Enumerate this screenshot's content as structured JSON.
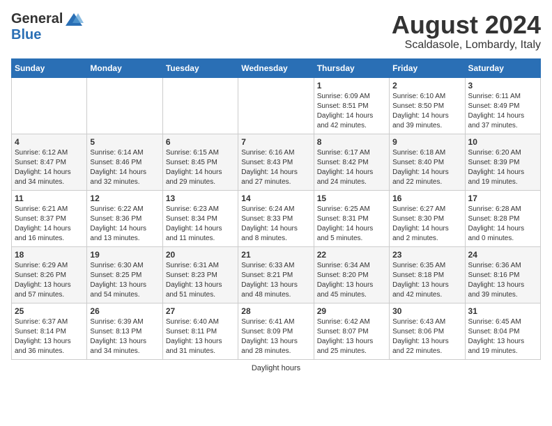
{
  "header": {
    "logo_line1": "General",
    "logo_line2": "Blue",
    "month_year": "August 2024",
    "location": "Scaldasole, Lombardy, Italy"
  },
  "days_of_week": [
    "Sunday",
    "Monday",
    "Tuesday",
    "Wednesday",
    "Thursday",
    "Friday",
    "Saturday"
  ],
  "weeks": [
    [
      {
        "day": "",
        "info": ""
      },
      {
        "day": "",
        "info": ""
      },
      {
        "day": "",
        "info": ""
      },
      {
        "day": "",
        "info": ""
      },
      {
        "day": "1",
        "info": "Sunrise: 6:09 AM\nSunset: 8:51 PM\nDaylight: 14 hours\nand 42 minutes."
      },
      {
        "day": "2",
        "info": "Sunrise: 6:10 AM\nSunset: 8:50 PM\nDaylight: 14 hours\nand 39 minutes."
      },
      {
        "day": "3",
        "info": "Sunrise: 6:11 AM\nSunset: 8:49 PM\nDaylight: 14 hours\nand 37 minutes."
      }
    ],
    [
      {
        "day": "4",
        "info": "Sunrise: 6:12 AM\nSunset: 8:47 PM\nDaylight: 14 hours\nand 34 minutes."
      },
      {
        "day": "5",
        "info": "Sunrise: 6:14 AM\nSunset: 8:46 PM\nDaylight: 14 hours\nand 32 minutes."
      },
      {
        "day": "6",
        "info": "Sunrise: 6:15 AM\nSunset: 8:45 PM\nDaylight: 14 hours\nand 29 minutes."
      },
      {
        "day": "7",
        "info": "Sunrise: 6:16 AM\nSunset: 8:43 PM\nDaylight: 14 hours\nand 27 minutes."
      },
      {
        "day": "8",
        "info": "Sunrise: 6:17 AM\nSunset: 8:42 PM\nDaylight: 14 hours\nand 24 minutes."
      },
      {
        "day": "9",
        "info": "Sunrise: 6:18 AM\nSunset: 8:40 PM\nDaylight: 14 hours\nand 22 minutes."
      },
      {
        "day": "10",
        "info": "Sunrise: 6:20 AM\nSunset: 8:39 PM\nDaylight: 14 hours\nand 19 minutes."
      }
    ],
    [
      {
        "day": "11",
        "info": "Sunrise: 6:21 AM\nSunset: 8:37 PM\nDaylight: 14 hours\nand 16 minutes."
      },
      {
        "day": "12",
        "info": "Sunrise: 6:22 AM\nSunset: 8:36 PM\nDaylight: 14 hours\nand 13 minutes."
      },
      {
        "day": "13",
        "info": "Sunrise: 6:23 AM\nSunset: 8:34 PM\nDaylight: 14 hours\nand 11 minutes."
      },
      {
        "day": "14",
        "info": "Sunrise: 6:24 AM\nSunset: 8:33 PM\nDaylight: 14 hours\nand 8 minutes."
      },
      {
        "day": "15",
        "info": "Sunrise: 6:25 AM\nSunset: 8:31 PM\nDaylight: 14 hours\nand 5 minutes."
      },
      {
        "day": "16",
        "info": "Sunrise: 6:27 AM\nSunset: 8:30 PM\nDaylight: 14 hours\nand 2 minutes."
      },
      {
        "day": "17",
        "info": "Sunrise: 6:28 AM\nSunset: 8:28 PM\nDaylight: 14 hours\nand 0 minutes."
      }
    ],
    [
      {
        "day": "18",
        "info": "Sunrise: 6:29 AM\nSunset: 8:26 PM\nDaylight: 13 hours\nand 57 minutes."
      },
      {
        "day": "19",
        "info": "Sunrise: 6:30 AM\nSunset: 8:25 PM\nDaylight: 13 hours\nand 54 minutes."
      },
      {
        "day": "20",
        "info": "Sunrise: 6:31 AM\nSunset: 8:23 PM\nDaylight: 13 hours\nand 51 minutes."
      },
      {
        "day": "21",
        "info": "Sunrise: 6:33 AM\nSunset: 8:21 PM\nDaylight: 13 hours\nand 48 minutes."
      },
      {
        "day": "22",
        "info": "Sunrise: 6:34 AM\nSunset: 8:20 PM\nDaylight: 13 hours\nand 45 minutes."
      },
      {
        "day": "23",
        "info": "Sunrise: 6:35 AM\nSunset: 8:18 PM\nDaylight: 13 hours\nand 42 minutes."
      },
      {
        "day": "24",
        "info": "Sunrise: 6:36 AM\nSunset: 8:16 PM\nDaylight: 13 hours\nand 39 minutes."
      }
    ],
    [
      {
        "day": "25",
        "info": "Sunrise: 6:37 AM\nSunset: 8:14 PM\nDaylight: 13 hours\nand 36 minutes."
      },
      {
        "day": "26",
        "info": "Sunrise: 6:39 AM\nSunset: 8:13 PM\nDaylight: 13 hours\nand 34 minutes."
      },
      {
        "day": "27",
        "info": "Sunrise: 6:40 AM\nSunset: 8:11 PM\nDaylight: 13 hours\nand 31 minutes."
      },
      {
        "day": "28",
        "info": "Sunrise: 6:41 AM\nSunset: 8:09 PM\nDaylight: 13 hours\nand 28 minutes."
      },
      {
        "day": "29",
        "info": "Sunrise: 6:42 AM\nSunset: 8:07 PM\nDaylight: 13 hours\nand 25 minutes."
      },
      {
        "day": "30",
        "info": "Sunrise: 6:43 AM\nSunset: 8:06 PM\nDaylight: 13 hours\nand 22 minutes."
      },
      {
        "day": "31",
        "info": "Sunrise: 6:45 AM\nSunset: 8:04 PM\nDaylight: 13 hours\nand 19 minutes."
      }
    ]
  ],
  "footer": {
    "note": "Daylight hours"
  }
}
